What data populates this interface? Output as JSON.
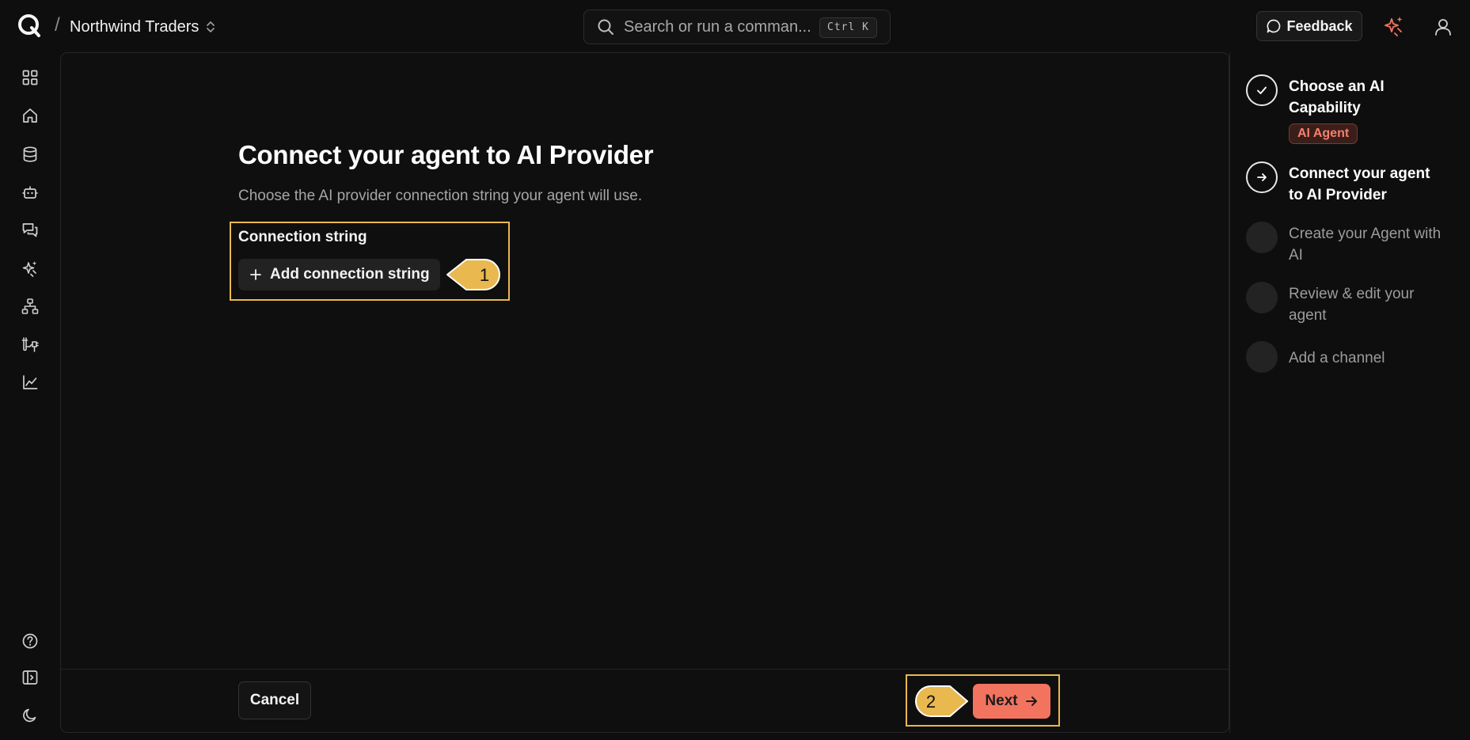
{
  "header": {
    "breadcrumb_separator": "/",
    "workspace_name": "Northwind Traders",
    "search_placeholder": "Search or run a comman...",
    "search_shortcut": "Ctrl K",
    "feedback_label": "Feedback"
  },
  "sidebar": {
    "items": [
      {
        "icon": "grid-icon"
      },
      {
        "icon": "home-icon"
      },
      {
        "icon": "database-icon"
      },
      {
        "icon": "robot-icon"
      },
      {
        "icon": "chat-icon"
      },
      {
        "icon": "sparkles-icon"
      },
      {
        "icon": "hierarchy-icon"
      },
      {
        "icon": "plug-icon"
      },
      {
        "icon": "chart-icon"
      }
    ],
    "bottom_items": [
      {
        "icon": "help-icon"
      },
      {
        "icon": "sidebar-toggle-icon"
      },
      {
        "icon": "moon-icon"
      }
    ]
  },
  "main": {
    "title": "Connect your agent to AI Provider",
    "subtitle": "Choose the AI provider connection string your agent will use.",
    "connection_label": "Connection string",
    "add_connection_label": "Add connection string",
    "callout_1": "1",
    "callout_2": "2",
    "cancel_label": "Cancel",
    "next_label": "Next"
  },
  "steps": [
    {
      "label": "Choose an AI Capability",
      "state": "done",
      "badge": "AI Agent"
    },
    {
      "label": "Connect your agent to AI Provider",
      "state": "current"
    },
    {
      "label": "Create your Agent with AI",
      "state": "todo"
    },
    {
      "label": "Review & edit your agent",
      "state": "todo"
    },
    {
      "label": "Add a channel",
      "state": "todo"
    }
  ],
  "colors": {
    "background": "#0e0e0e",
    "accent": "#f2745f",
    "highlight": "#e9b84f",
    "badge_text": "#f6806c"
  }
}
